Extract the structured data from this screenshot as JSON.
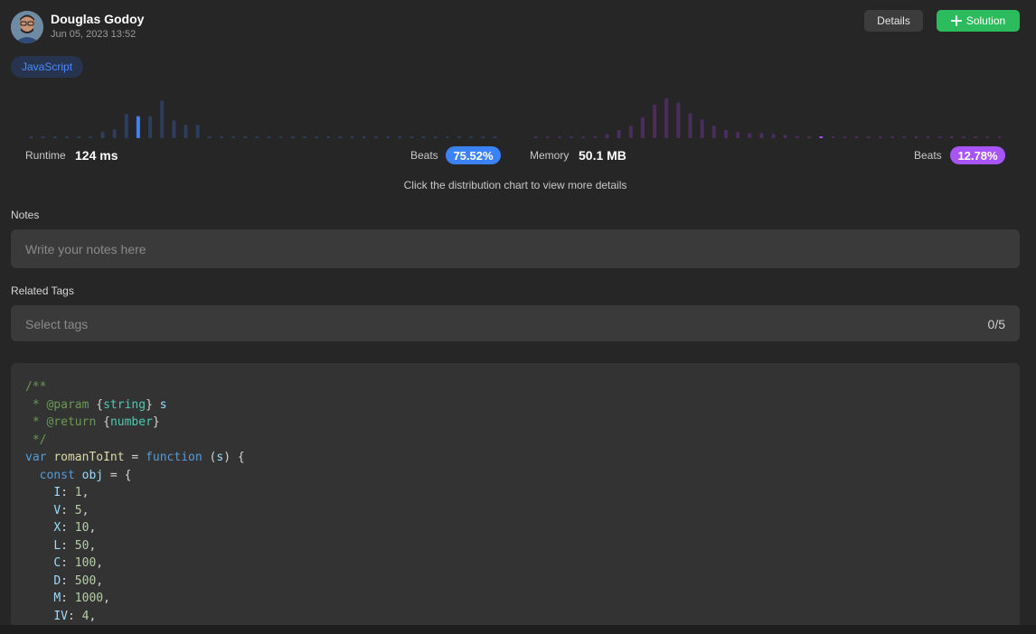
{
  "header": {
    "user_name": "Douglas Godoy",
    "timestamp": "Jun 05, 2023 13:52",
    "details_label": "Details",
    "solution_label": "Solution"
  },
  "language_tag": "JavaScript",
  "runtime": {
    "label": "Runtime",
    "value": "124 ms",
    "beats_label": "Beats",
    "beats_value": "75.52%",
    "accent_color": "#3b82f6",
    "bar_color": "#2c3d5e"
  },
  "memory": {
    "label": "Memory",
    "value": "50.1 MB",
    "beats_label": "Beats",
    "beats_value": "12.78%",
    "accent_color": "#a855f7",
    "bar_color": "#4a2c5e"
  },
  "hint": "Click the distribution chart to view more details",
  "notes": {
    "label": "Notes",
    "placeholder": "Write your notes here"
  },
  "related_tags": {
    "label": "Related Tags",
    "placeholder": "Select tags",
    "count": "0/5"
  },
  "chart_data": [
    {
      "type": "bar",
      "name": "Runtime distribution",
      "values": [
        0.3,
        0.3,
        0.3,
        0.3,
        0.3,
        0.3,
        1.5,
        2,
        5.5,
        5,
        5,
        8.5,
        4,
        3,
        3,
        0.3,
        0.3,
        0.3,
        0.3,
        0.3,
        0.3,
        0.3,
        0.3,
        0.3,
        0.3,
        0.3,
        0.3,
        0.3,
        0.3,
        0.3,
        0.3,
        0.3,
        0.3,
        0.3,
        0.3,
        0.3,
        0.3,
        0.3,
        0.3,
        0.3
      ],
      "highlight_index": 9,
      "ylim": [
        0,
        9
      ]
    },
    {
      "type": "bar",
      "name": "Memory distribution",
      "values": [
        0.3,
        0.3,
        0.3,
        0.3,
        0.3,
        0.5,
        1,
        2,
        3,
        5,
        8,
        9.5,
        8.5,
        6,
        4.5,
        3,
        2,
        1.5,
        1.2,
        1.2,
        1,
        0.8,
        0.5,
        0.4,
        0.3,
        0.3,
        0.3,
        0.3,
        0.3,
        0.3,
        0.3,
        0.3,
        0.3,
        0.3,
        0.3,
        0.3,
        0.3,
        0.3,
        0.3,
        0.3
      ],
      "highlight_index": 24,
      "ylim": [
        0,
        9.5
      ]
    }
  ],
  "code_lines": [
    [
      [
        "/**",
        "tk-comment"
      ]
    ],
    [
      [
        " * ",
        "tk-comment"
      ],
      [
        "@param",
        "tk-comment"
      ],
      [
        " {",
        ""
      ],
      [
        "string",
        "tk-type"
      ],
      [
        "} ",
        ""
      ],
      [
        "s",
        "tk-var"
      ]
    ],
    [
      [
        " * ",
        "tk-comment"
      ],
      [
        "@return",
        "tk-comment"
      ],
      [
        " {",
        ""
      ],
      [
        "number",
        "tk-type"
      ],
      [
        "}",
        ""
      ]
    ],
    [
      [
        " */",
        "tk-comment"
      ]
    ],
    [
      [
        "var",
        "tk-keyword"
      ],
      [
        " ",
        ""
      ],
      [
        "romanToInt",
        "tk-func"
      ],
      [
        " = ",
        ""
      ],
      [
        "function",
        "tk-keyword"
      ],
      [
        " (",
        ""
      ],
      [
        "s",
        "tk-var"
      ],
      [
        ") {",
        ""
      ]
    ],
    [
      [
        "  ",
        ""
      ],
      [
        "const",
        "tk-keyword"
      ],
      [
        " ",
        ""
      ],
      [
        "obj",
        "tk-var"
      ],
      [
        " = {",
        ""
      ]
    ],
    [
      [
        "    ",
        ""
      ],
      [
        "I",
        "tk-var"
      ],
      [
        ": ",
        ""
      ],
      [
        "1",
        "tk-num"
      ],
      [
        ",",
        ""
      ]
    ],
    [
      [
        "    ",
        ""
      ],
      [
        "V",
        "tk-var"
      ],
      [
        ": ",
        ""
      ],
      [
        "5",
        "tk-num"
      ],
      [
        ",",
        ""
      ]
    ],
    [
      [
        "    ",
        ""
      ],
      [
        "X",
        "tk-var"
      ],
      [
        ": ",
        ""
      ],
      [
        "10",
        "tk-num"
      ],
      [
        ",",
        ""
      ]
    ],
    [
      [
        "    ",
        ""
      ],
      [
        "L",
        "tk-var"
      ],
      [
        ": ",
        ""
      ],
      [
        "50",
        "tk-num"
      ],
      [
        ",",
        ""
      ]
    ],
    [
      [
        "    ",
        ""
      ],
      [
        "C",
        "tk-var"
      ],
      [
        ": ",
        ""
      ],
      [
        "100",
        "tk-num"
      ],
      [
        ",",
        ""
      ]
    ],
    [
      [
        "    ",
        ""
      ],
      [
        "D",
        "tk-var"
      ],
      [
        ": ",
        ""
      ],
      [
        "500",
        "tk-num"
      ],
      [
        ",",
        ""
      ]
    ],
    [
      [
        "    ",
        ""
      ],
      [
        "M",
        "tk-var"
      ],
      [
        ": ",
        ""
      ],
      [
        "1000",
        "tk-num"
      ],
      [
        ",",
        ""
      ]
    ],
    [
      [
        "    ",
        ""
      ],
      [
        "IV",
        "tk-var"
      ],
      [
        ": ",
        ""
      ],
      [
        "4",
        "tk-num"
      ],
      [
        ",",
        ""
      ]
    ]
  ]
}
